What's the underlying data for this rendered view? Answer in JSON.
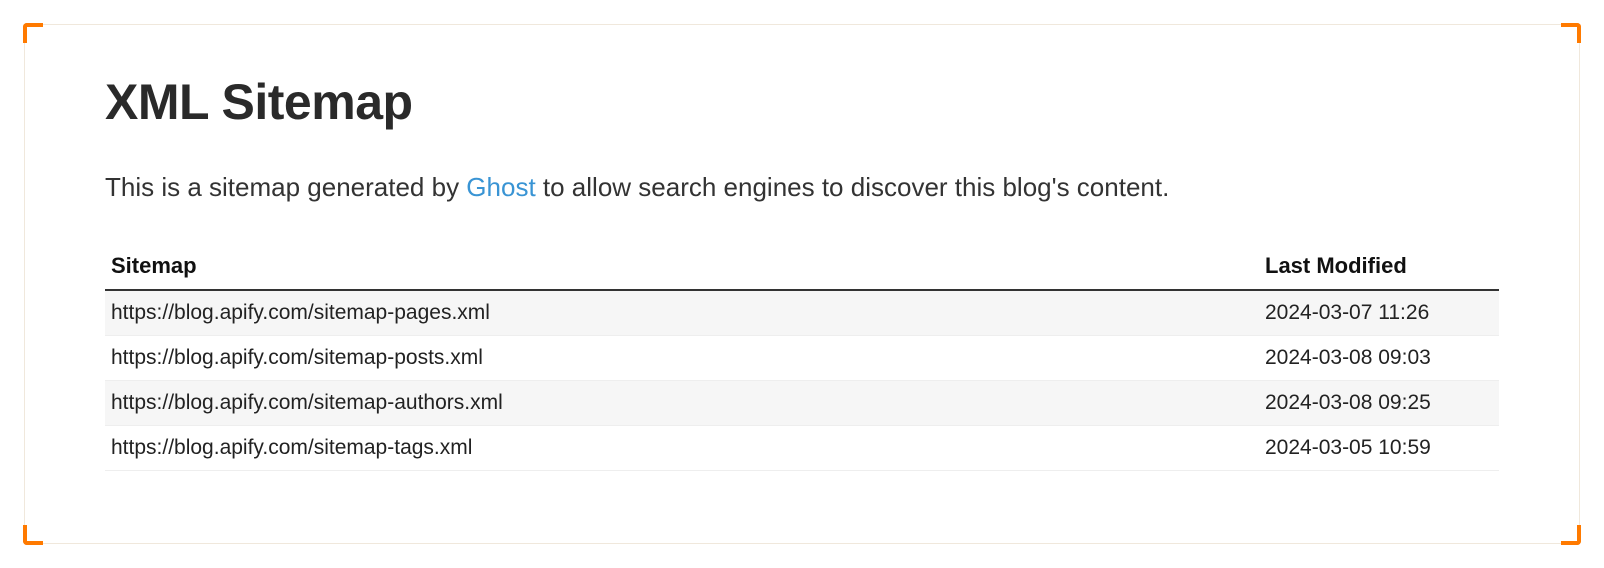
{
  "title": "XML Sitemap",
  "description": {
    "before": "This is a sitemap generated by ",
    "link_text": "Ghost",
    "after": " to allow search engines to discover this blog's content."
  },
  "table": {
    "headers": {
      "sitemap": "Sitemap",
      "last_modified": "Last Modified"
    },
    "rows": [
      {
        "url": "https://blog.apify.com/sitemap-pages.xml",
        "modified": "2024-03-07 11:26"
      },
      {
        "url": "https://blog.apify.com/sitemap-posts.xml",
        "modified": "2024-03-08 09:03"
      },
      {
        "url": "https://blog.apify.com/sitemap-authors.xml",
        "modified": "2024-03-08 09:25"
      },
      {
        "url": "https://blog.apify.com/sitemap-tags.xml",
        "modified": "2024-03-05 10:59"
      }
    ]
  }
}
